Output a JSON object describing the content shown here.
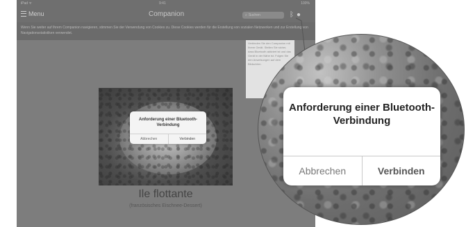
{
  "status_bar": {
    "left": "iPad ᯤ",
    "time": "9:41",
    "right": "100%"
  },
  "nav": {
    "menu_label": "Menu",
    "title": "Companion",
    "search_placeholder": "Suchen"
  },
  "cookie_banner": {
    "text": "Wenn Sie weiter auf Ihrem Companion navigieren, stimmen Sie der Verwendung von Cookies zu. Diese Cookies werden für die Erstellung von sozialen Netzwerken und zur Erstellung von Navigationsstatistiken verwendet."
  },
  "side_notice": {
    "text": "Verbinden Sie den Companion mit Ihrem Gerät. Stellen Sie sicher, dass Bluetooth aktiviert ist und das Gerät in der Nähe ist. Folgen Sie den Anweisungen auf dem Bildschirm."
  },
  "alert": {
    "title": "Anforderung einer Bluetooth-Verbindung",
    "cancel": "Abbrechen",
    "confirm": "Verbinden"
  },
  "dish": {
    "title": "Ile flottante",
    "subtitle": "(französisches Eischnee-Dessert)"
  }
}
